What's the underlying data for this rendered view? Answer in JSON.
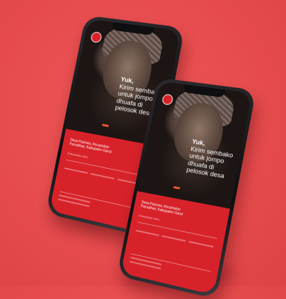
{
  "phones": [
    {
      "greeting": "Yuk,",
      "headline": "Kirim sembako untuk jompo dhuafa di pelosok desa",
      "location": "Desa Pasirara, Kecamatan Pamulihan, Kabupaten Garut",
      "date": "8 November 2021"
    },
    {
      "greeting": "Yuk,",
      "headline": "Kirim sembako untuk jompo dhuafa di pelosok desa",
      "location": "Desa Pasirara, Kecamatan Pamulihan, Kabupaten Garut",
      "date": "8 November 2021"
    }
  ],
  "colors": {
    "background": "#e64a4c",
    "screen_red": "#d8222a",
    "accent": "#f05a28"
  }
}
